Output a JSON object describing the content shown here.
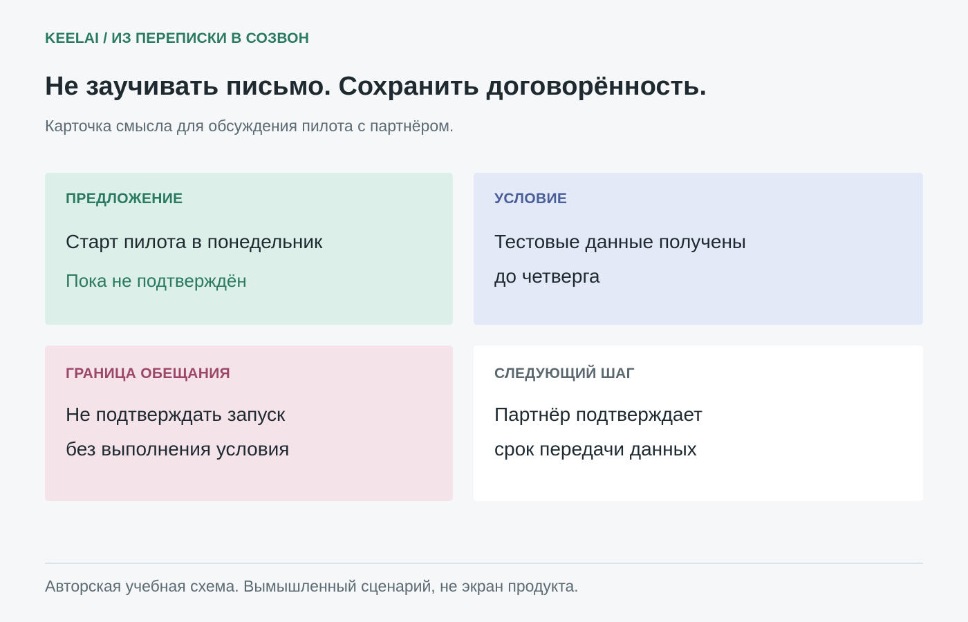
{
  "header": {
    "eyebrow": "KEELAI / ИЗ ПЕРЕПИСКИ В СОЗВОН",
    "title": "Не заучивать письмо. Сохранить договорённость.",
    "subtitle": "Карточка смысла для обсуждения пилота с партнёром."
  },
  "cards": {
    "offer": {
      "label": "ПРЕДЛОЖЕНИЕ",
      "lines": [
        "Старт пилота в понедельник"
      ],
      "note": "Пока не подтверждён",
      "background": "#dcefe8",
      "accent": "#2a7a62"
    },
    "condition": {
      "label": "УСЛОВИЕ",
      "lines": [
        "Тестовые данные получены",
        "до четверга"
      ],
      "background": "#e3e9f7",
      "accent": "#4a5f99"
    },
    "boundary": {
      "label": "ГРАНИЦА ОБЕЩАНИЯ",
      "lines": [
        "Не подтверждать запуск",
        "без выполнения условия"
      ],
      "background": "#f4e3e9",
      "accent": "#9c4668"
    },
    "next": {
      "label": "СЛЕДУЮЩИЙ ШАГ",
      "lines": [
        "Партнёр подтверждает",
        "срок передачи данных"
      ],
      "background": "#ffffff",
      "accent": "#5b6870"
    }
  },
  "footer": {
    "text": "Авторская учебная схема. Вымышленный сценарий, не экран продукта."
  }
}
